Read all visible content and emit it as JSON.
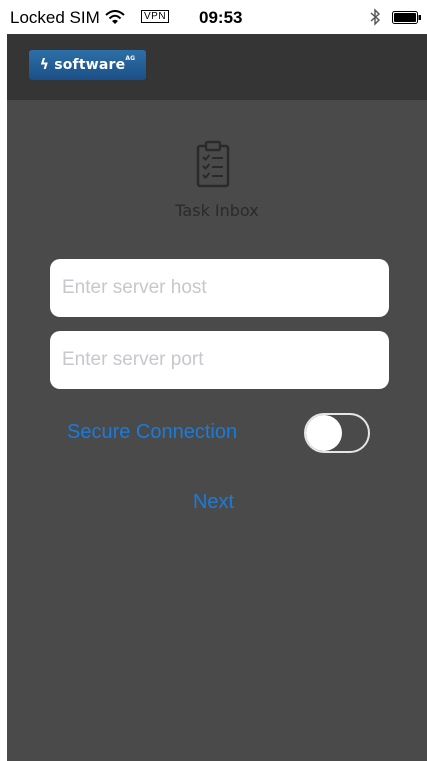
{
  "status_bar": {
    "carrier": "Locked SIM",
    "vpn": "VPN",
    "time": "09:53"
  },
  "header": {
    "logo_text": "software",
    "logo_suffix": "AG",
    "logo_color": "#1f5a95"
  },
  "app": {
    "title": "Task Inbox"
  },
  "form": {
    "host_placeholder": "Enter server host",
    "host_value": "",
    "port_placeholder": "Enter server port",
    "port_value": "",
    "secure_label": "Secure Connection",
    "secure_enabled": false,
    "next_label": "Next"
  },
  "colors": {
    "background": "#4a4a4a",
    "header": "#353535",
    "accent": "#1c7bd9"
  }
}
